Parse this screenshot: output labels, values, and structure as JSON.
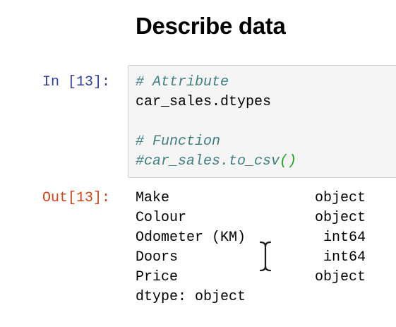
{
  "heading": "Describe data",
  "input_cell": {
    "prompt": "In [13]:",
    "lines": [
      {
        "text": "# Attribute",
        "kind": "comment"
      },
      {
        "text": "car_sales.dtypes",
        "kind": "code"
      },
      {
        "text": "# Function",
        "kind": "comment"
      },
      {
        "text": "#car_sales.to_csv",
        "kind": "comment",
        "suffix": "()"
      }
    ]
  },
  "output_cell": {
    "prompt": "Out[13]:",
    "rows": [
      {
        "key": "Make",
        "value": "object"
      },
      {
        "key": "Colour",
        "value": "object"
      },
      {
        "key": "Odometer (KM)",
        "value": "int64"
      },
      {
        "key": "Doors",
        "value": "int64"
      },
      {
        "key": "Price",
        "value": "object"
      }
    ],
    "footer": "dtype: object"
  },
  "colors": {
    "in_prompt": "#303f9f",
    "out_prompt": "#d84315",
    "comment": "#408080",
    "paren": "#19a319",
    "cell_background": "#f5f5f5"
  },
  "icons": [
    "text-cursor-icon"
  ]
}
